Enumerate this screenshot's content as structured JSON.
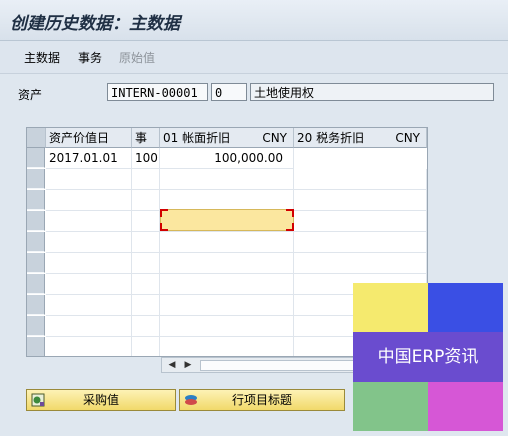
{
  "title": "创建历史数据：主数据",
  "menu": [
    "主数据",
    "事务",
    "原始值"
  ],
  "asset": {
    "label": "资产",
    "number": "INTERN-00001",
    "subnumber": "0",
    "description": "土地使用权"
  },
  "grid": {
    "headers": [
      "资产价值日",
      "事",
      "01 帐面折旧",
      "CNY",
      "20 税务折旧",
      "CNY"
    ],
    "rows": [
      {
        "date": "2017.01.01",
        "tx": "100",
        "amount": "100,000.00"
      }
    ]
  },
  "buttons": {
    "purchase": "采购值",
    "line_title": "行项目标题"
  },
  "watermark": "中国ERP资讯"
}
